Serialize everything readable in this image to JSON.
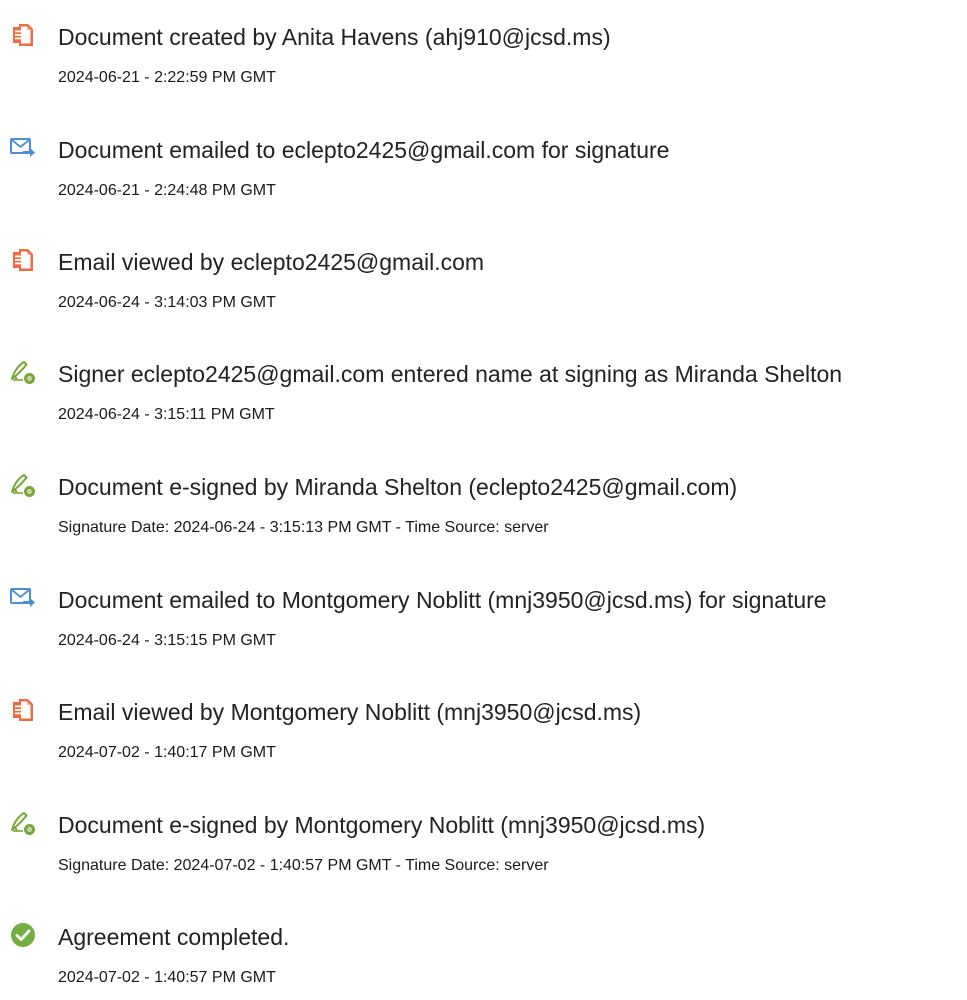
{
  "colors": {
    "doc_icon": "#ef6c43",
    "mail_icon": "#4a8fd6",
    "sign_icon": "#7ba637",
    "check_icon": "#74ad44"
  },
  "events": [
    {
      "icon": "document-icon",
      "title": "Document created by Anita Havens (ahj910@jcsd.ms)",
      "detail": "2024-06-21 - 2:22:59 PM GMT"
    },
    {
      "icon": "email-sent-icon",
      "title": "Document emailed to eclepto2425@gmail.com for signature",
      "detail": "2024-06-21 - 2:24:48 PM GMT"
    },
    {
      "icon": "document-icon",
      "title": "Email viewed by eclepto2425@gmail.com",
      "detail": "2024-06-24 - 3:14:03 PM GMT"
    },
    {
      "icon": "signature-pen-icon",
      "title": "Signer eclepto2425@gmail.com entered name at signing as Miranda Shelton",
      "detail": "2024-06-24 - 3:15:11 PM GMT"
    },
    {
      "icon": "signature-pen-icon",
      "title": "Document e-signed by Miranda Shelton (eclepto2425@gmail.com)",
      "detail": "Signature Date: 2024-06-24 - 3:15:13 PM GMT - Time Source: server"
    },
    {
      "icon": "email-sent-icon",
      "title": "Document emailed to Montgomery Noblitt (mnj3950@jcsd.ms) for signature",
      "detail": "2024-06-24 - 3:15:15 PM GMT"
    },
    {
      "icon": "document-icon",
      "title": "Email viewed by Montgomery Noblitt (mnj3950@jcsd.ms)",
      "detail": "2024-07-02 - 1:40:17 PM GMT"
    },
    {
      "icon": "signature-pen-icon",
      "title": "Document e-signed by Montgomery Noblitt (mnj3950@jcsd.ms)",
      "detail": "Signature Date: 2024-07-02 - 1:40:57 PM GMT - Time Source: server"
    },
    {
      "icon": "checkmark-circle-icon",
      "title": "Agreement completed.",
      "detail": "2024-07-02 - 1:40:57 PM GMT"
    }
  ]
}
